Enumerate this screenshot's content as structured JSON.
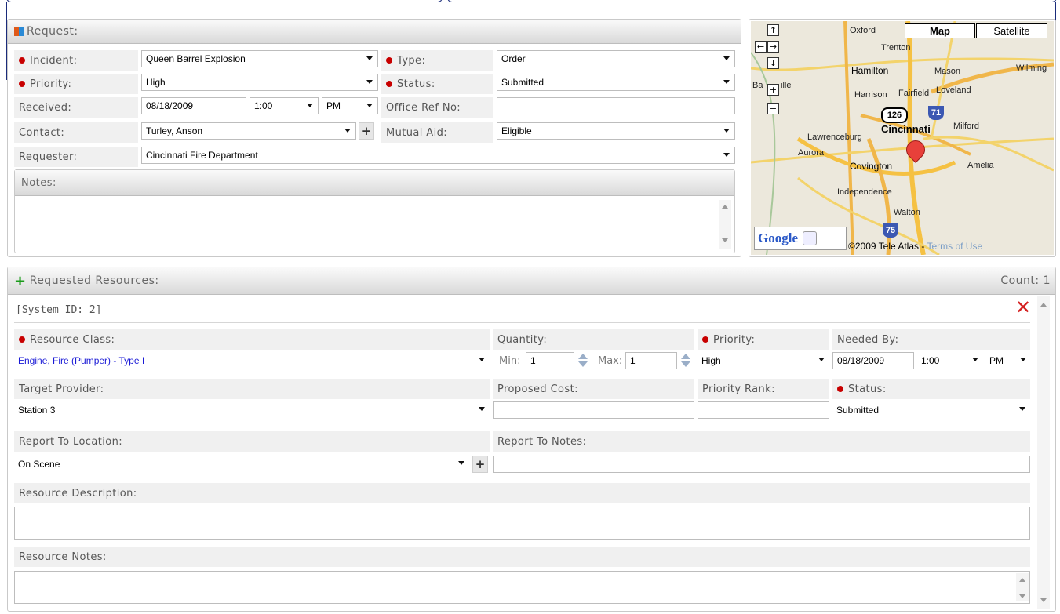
{
  "request": {
    "title": "Request:",
    "fields": {
      "incident": {
        "label": "Incident:",
        "value": "Queen Barrel Explosion"
      },
      "type": {
        "label": "Type:",
        "value": "Order"
      },
      "priority": {
        "label": "Priority:",
        "value": "High"
      },
      "status": {
        "label": "Status:",
        "value": "Submitted"
      },
      "received": {
        "label": "Received:",
        "date": "08/18/2009",
        "time": "1:00",
        "ampm": "PM"
      },
      "office_ref": {
        "label": "Office Ref No:",
        "value": ""
      },
      "contact": {
        "label": "Contact:",
        "value": "Turley, Anson",
        "add": "+"
      },
      "mutual_aid": {
        "label": "Mutual Aid:",
        "value": "Eligible"
      },
      "requester": {
        "label": "Requester:",
        "value": "Cincinnati Fire Department"
      }
    },
    "notes": {
      "title": "Notes:",
      "value": ""
    }
  },
  "map": {
    "map_button": "Map",
    "satellite_button": "Satellite",
    "places": [
      "Oxford",
      "Trenton",
      "Hamilton",
      "Mason",
      "Wilming",
      "Ba",
      "ille",
      "Harrison",
      "Fairfield",
      "Loveland",
      "Lawrenceburg",
      "Cincinnati",
      "Milford",
      "Aurora",
      "Covington",
      "Amelia",
      "Independence",
      "Walton"
    ],
    "shields": [
      "126",
      "71",
      "75"
    ],
    "logo": "Google",
    "copyright": "©2009 Tele Atlas - ",
    "terms": "Terms of Use",
    "nav": {
      "up": "↑",
      "left": "←",
      "right": "→",
      "down": "↓",
      "zoom_in": "+",
      "zoom_out": "−"
    }
  },
  "resources": {
    "title": "Requested Resources:",
    "count_label": "Count: 1",
    "system_id": "[System ID: 2]",
    "resource_class": {
      "label": "Resource Class:",
      "value": "Engine, Fire (Pumper) - Type I"
    },
    "quantity": {
      "label": "Quantity:",
      "min_label": "Min:",
      "min": "1",
      "max_label": "Max:",
      "max": "1"
    },
    "priority": {
      "label": "Priority:",
      "value": "High"
    },
    "needed_by": {
      "label": "Needed By:",
      "date": "08/18/2009",
      "time": "1:00",
      "ampm": "PM"
    },
    "target_provider": {
      "label": "Target Provider:",
      "value": "Station 3"
    },
    "proposed_cost": {
      "label": "Proposed Cost:",
      "value": ""
    },
    "priority_rank": {
      "label": "Priority Rank:",
      "value": ""
    },
    "status": {
      "label": "Status:",
      "value": "Submitted"
    },
    "report_location": {
      "label": "Report To Location:",
      "value": "On Scene",
      "add": "+"
    },
    "report_notes": {
      "label": "Report To Notes:",
      "value": ""
    },
    "description": {
      "label": "Resource Description:",
      "value": ""
    },
    "notes": {
      "label": "Resource Notes:",
      "value": ""
    }
  },
  "colors": {
    "required": "#c80000",
    "link": "#1a1ad6",
    "delete": "#d42020",
    "brace": "#1a2b7a"
  }
}
